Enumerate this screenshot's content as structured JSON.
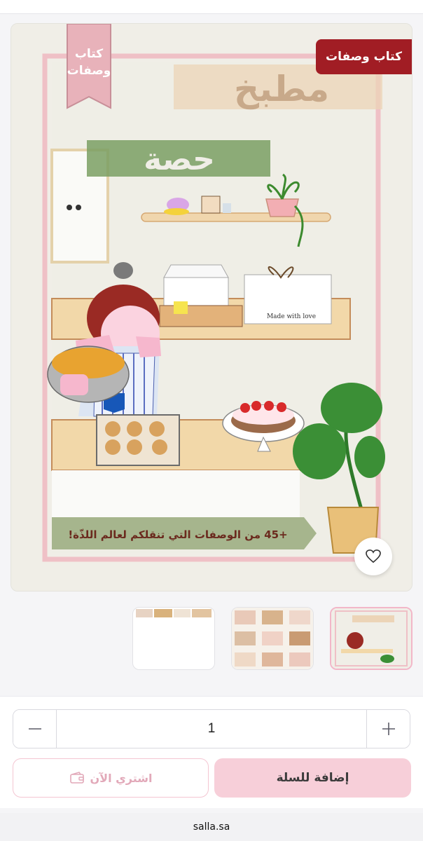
{
  "product": {
    "badge": "كتاب وصفات",
    "cover": {
      "ribbon_line1": "كتاب",
      "ribbon_line2": "وصفات",
      "title_line1": "مطبخ",
      "title_line2": "حصة",
      "banner": "+45 من الوصفات التي تنقلكم لعالم اللذّة!",
      "note_label": "Made with love"
    },
    "wishlist_icon": "heart-icon"
  },
  "thumbnails": [
    {
      "name": "cover",
      "active": true
    },
    {
      "name": "recipes-grid",
      "active": false
    },
    {
      "name": "recipes-strip",
      "active": false
    }
  ],
  "cart": {
    "quantity": "1",
    "minus_icon": "minus-icon",
    "plus_icon": "plus-icon",
    "buy_now_label": "اشتري الآن",
    "buy_now_icon": "wallet-icon",
    "add_to_cart_label": "إضافة للسلة"
  },
  "browser": {
    "url": "salla.sa"
  },
  "colors": {
    "badge": "#a11d24",
    "primary_pink": "#f7cfd9",
    "pink_border": "#f4c6d2"
  }
}
